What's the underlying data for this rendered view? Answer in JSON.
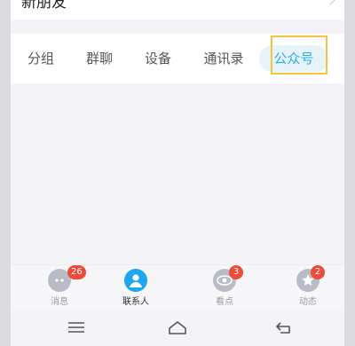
{
  "header": {
    "new_friends_label": "新朋友"
  },
  "tabs": [
    {
      "label": "分组"
    },
    {
      "label": "群聊"
    },
    {
      "label": "设备"
    },
    {
      "label": "通讯录"
    },
    {
      "label": "公众号",
      "selected": true
    }
  ],
  "bottom_nav": [
    {
      "label": "消息",
      "badge": "26",
      "icon": "chat-icon"
    },
    {
      "label": "联系人",
      "badge": "",
      "icon": "contact-icon",
      "active": true
    },
    {
      "label": "看点",
      "badge": "3",
      "icon": "eye-icon"
    },
    {
      "label": "动态",
      "badge": "2",
      "icon": "star-icon"
    }
  ],
  "colors": {
    "accent": "#1ea6ef",
    "badge": "#f04a3a",
    "highlight": "#f5c43a"
  },
  "system_bar": {
    "buttons": [
      "menu-icon",
      "home-icon",
      "back-icon"
    ]
  }
}
